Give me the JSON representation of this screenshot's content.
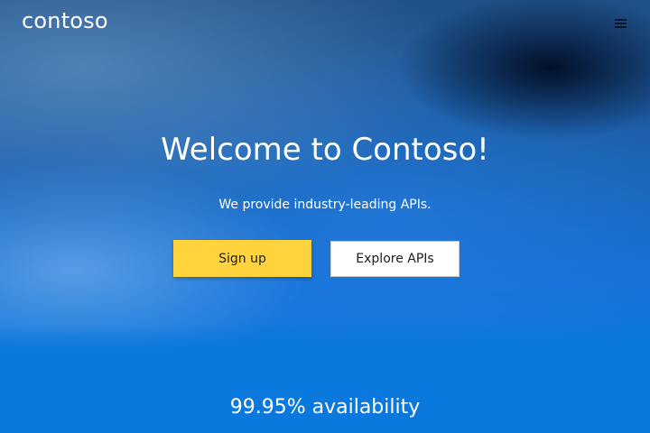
{
  "header": {
    "logo_text": "contoso",
    "menu_icon": "hamburger-menu-icon"
  },
  "hero": {
    "title": "Welcome to Contoso!",
    "tagline": "We provide industry-leading APIs.",
    "signup_label": "Sign up",
    "explore_label": "Explore APIs"
  },
  "stats": {
    "availability_text": "99.95% availability"
  },
  "colors": {
    "primary_blue": "#0a78dc",
    "signup_yellow": "#ffd33d",
    "text_white": "#ffffff"
  }
}
